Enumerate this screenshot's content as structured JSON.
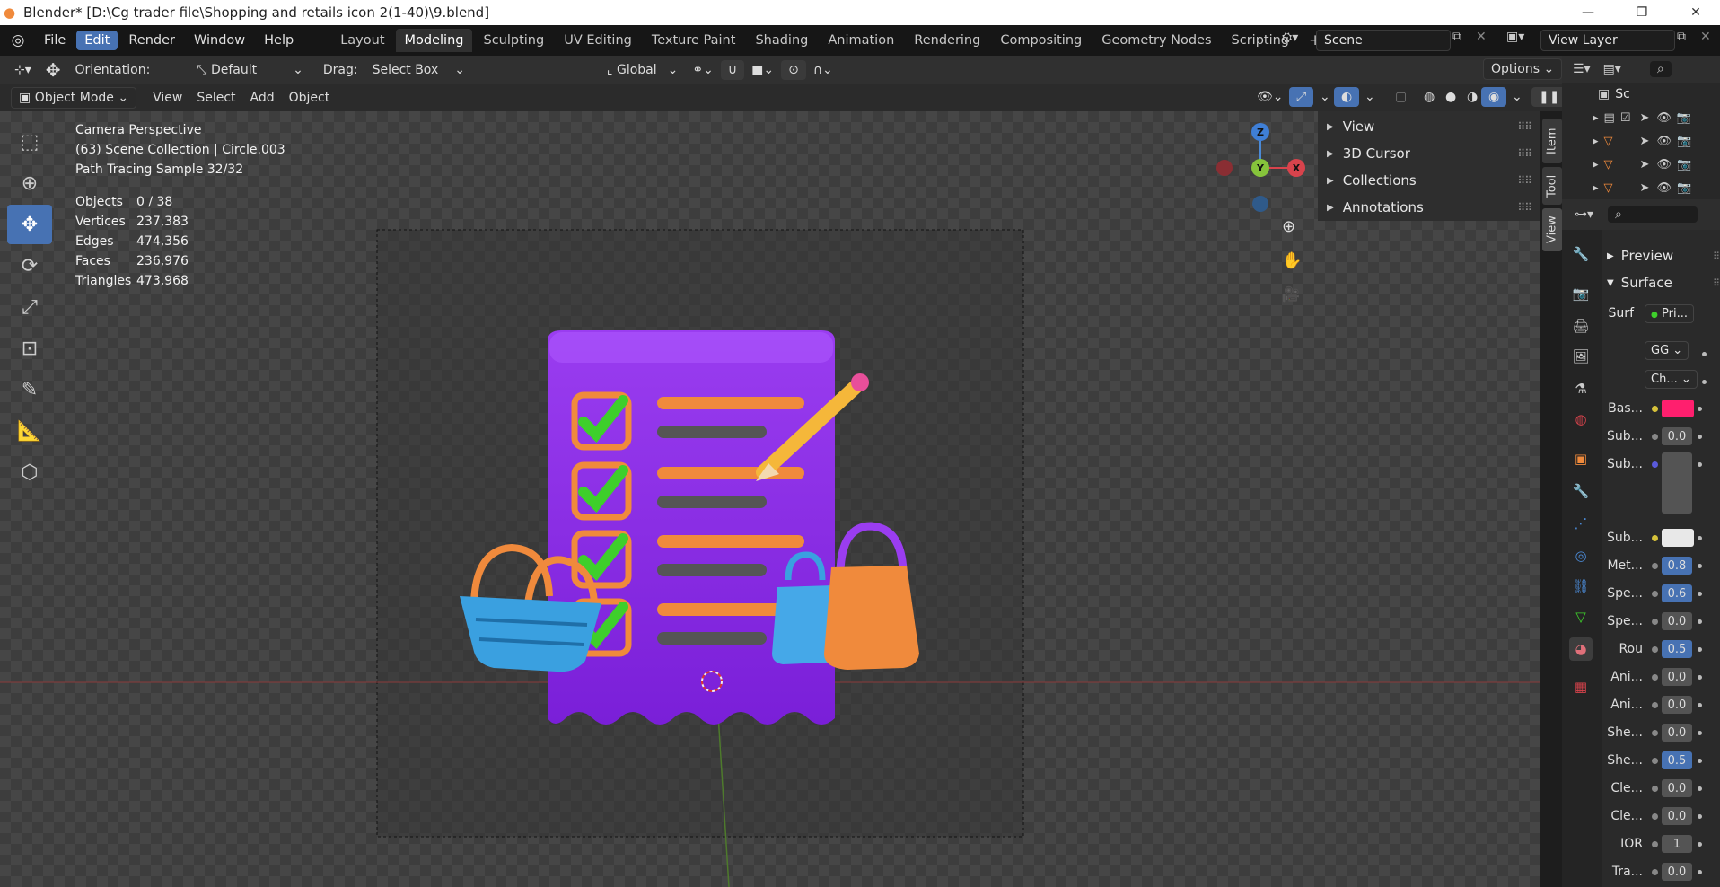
{
  "window": {
    "title": "Blender* [D:\\Cg trader file\\Shopping and retails icon 2(1-40)\\9.blend]",
    "minimize": "—",
    "maximize": "❐",
    "close": "✕"
  },
  "menubar": {
    "items": [
      "File",
      "Edit",
      "Render",
      "Window",
      "Help"
    ],
    "active_menu": "Edit",
    "workspaces": [
      "Layout",
      "Modeling",
      "Sculpting",
      "UV Editing",
      "Texture Paint",
      "Shading",
      "Animation",
      "Rendering",
      "Compositing",
      "Geometry Nodes",
      "Scripting"
    ],
    "active_workspace": "Modeling",
    "add_tab": "+",
    "scene": "Scene",
    "view_layer": "View Layer"
  },
  "toolheader": {
    "orientation_label": "Orientation:",
    "orientation_value": "Default",
    "drag_label": "Drag:",
    "drag_value": "Select Box",
    "transform_orientation": "Global",
    "options": "Options"
  },
  "viewport_header": {
    "mode": "Object Mode",
    "menus": [
      "View",
      "Select",
      "Add",
      "Object"
    ]
  },
  "overlay": {
    "camera": "Camera Perspective",
    "collection": "(63) Scene Collection | Circle.003",
    "sample": "Path Tracing Sample 32/32",
    "stats": [
      {
        "label": "Objects",
        "value": "0 / 38"
      },
      {
        "label": "Vertices",
        "value": "237,383"
      },
      {
        "label": "Edges",
        "value": "474,356"
      },
      {
        "label": "Faces",
        "value": "236,976"
      },
      {
        "label": "Triangles",
        "value": "473,968"
      }
    ]
  },
  "gizmo": {
    "z": "Z",
    "y": "Y",
    "x": "X"
  },
  "npanel": {
    "sections": [
      "View",
      "3D Cursor",
      "Collections",
      "Annotations"
    ],
    "tabs": [
      "Item",
      "Tool",
      "View"
    ]
  },
  "outliner": {
    "root": "Sc"
  },
  "properties": {
    "preview": "Preview",
    "surface": "Surface",
    "surf_label": "Surf",
    "surf_value": "Pri...",
    "gg": "GG",
    "ch": "Ch...",
    "rows": [
      {
        "label": "Bas...",
        "value": "",
        "kind": "color",
        "color": "#ff1f6e",
        "dot": "#d6c23a"
      },
      {
        "label": "Sub...",
        "value": "0.0",
        "kind": "num",
        "dot": "#888888"
      },
      {
        "label": "Sub...",
        "value": "",
        "kind": "vec",
        "dot": "#5a5adb"
      },
      {
        "label": "Sub...",
        "value": "",
        "kind": "color",
        "color": "#e8e8e8",
        "dot": "#d6c23a"
      },
      {
        "label": "Met...",
        "value": "0.8",
        "kind": "num",
        "blue": true,
        "dot": "#888888"
      },
      {
        "label": "Spe...",
        "value": "0.6",
        "kind": "num",
        "blue": true,
        "dot": "#888888"
      },
      {
        "label": "Spe...",
        "value": "0.0",
        "kind": "num",
        "dot": "#888888"
      },
      {
        "label": "Rou",
        "value": "0.5",
        "kind": "num",
        "blue": true,
        "dot": "#888888"
      },
      {
        "label": "Ani...",
        "value": "0.0",
        "kind": "num",
        "dot": "#888888"
      },
      {
        "label": "Ani...",
        "value": "0.0",
        "kind": "num",
        "dot": "#888888"
      },
      {
        "label": "She...",
        "value": "0.0",
        "kind": "num",
        "dot": "#888888"
      },
      {
        "label": "She...",
        "value": "0.5",
        "kind": "num",
        "blue": true,
        "dot": "#888888"
      },
      {
        "label": "Cle...",
        "value": "0.0",
        "kind": "num",
        "dot": "#888888"
      },
      {
        "label": "Cle...",
        "value": "0.0",
        "kind": "num",
        "dot": "#888888"
      },
      {
        "label": "IOR",
        "value": "1",
        "kind": "num",
        "dot": "#888888"
      },
      {
        "label": "Tra...",
        "value": "0.0",
        "kind": "num",
        "dot": "#888888"
      }
    ]
  },
  "colors": {
    "accent": "#4772b3",
    "receipt": "#8a2be2",
    "check": "#3ecf2b",
    "orange": "#f08a3c",
    "basket": "#3aa0e0"
  }
}
